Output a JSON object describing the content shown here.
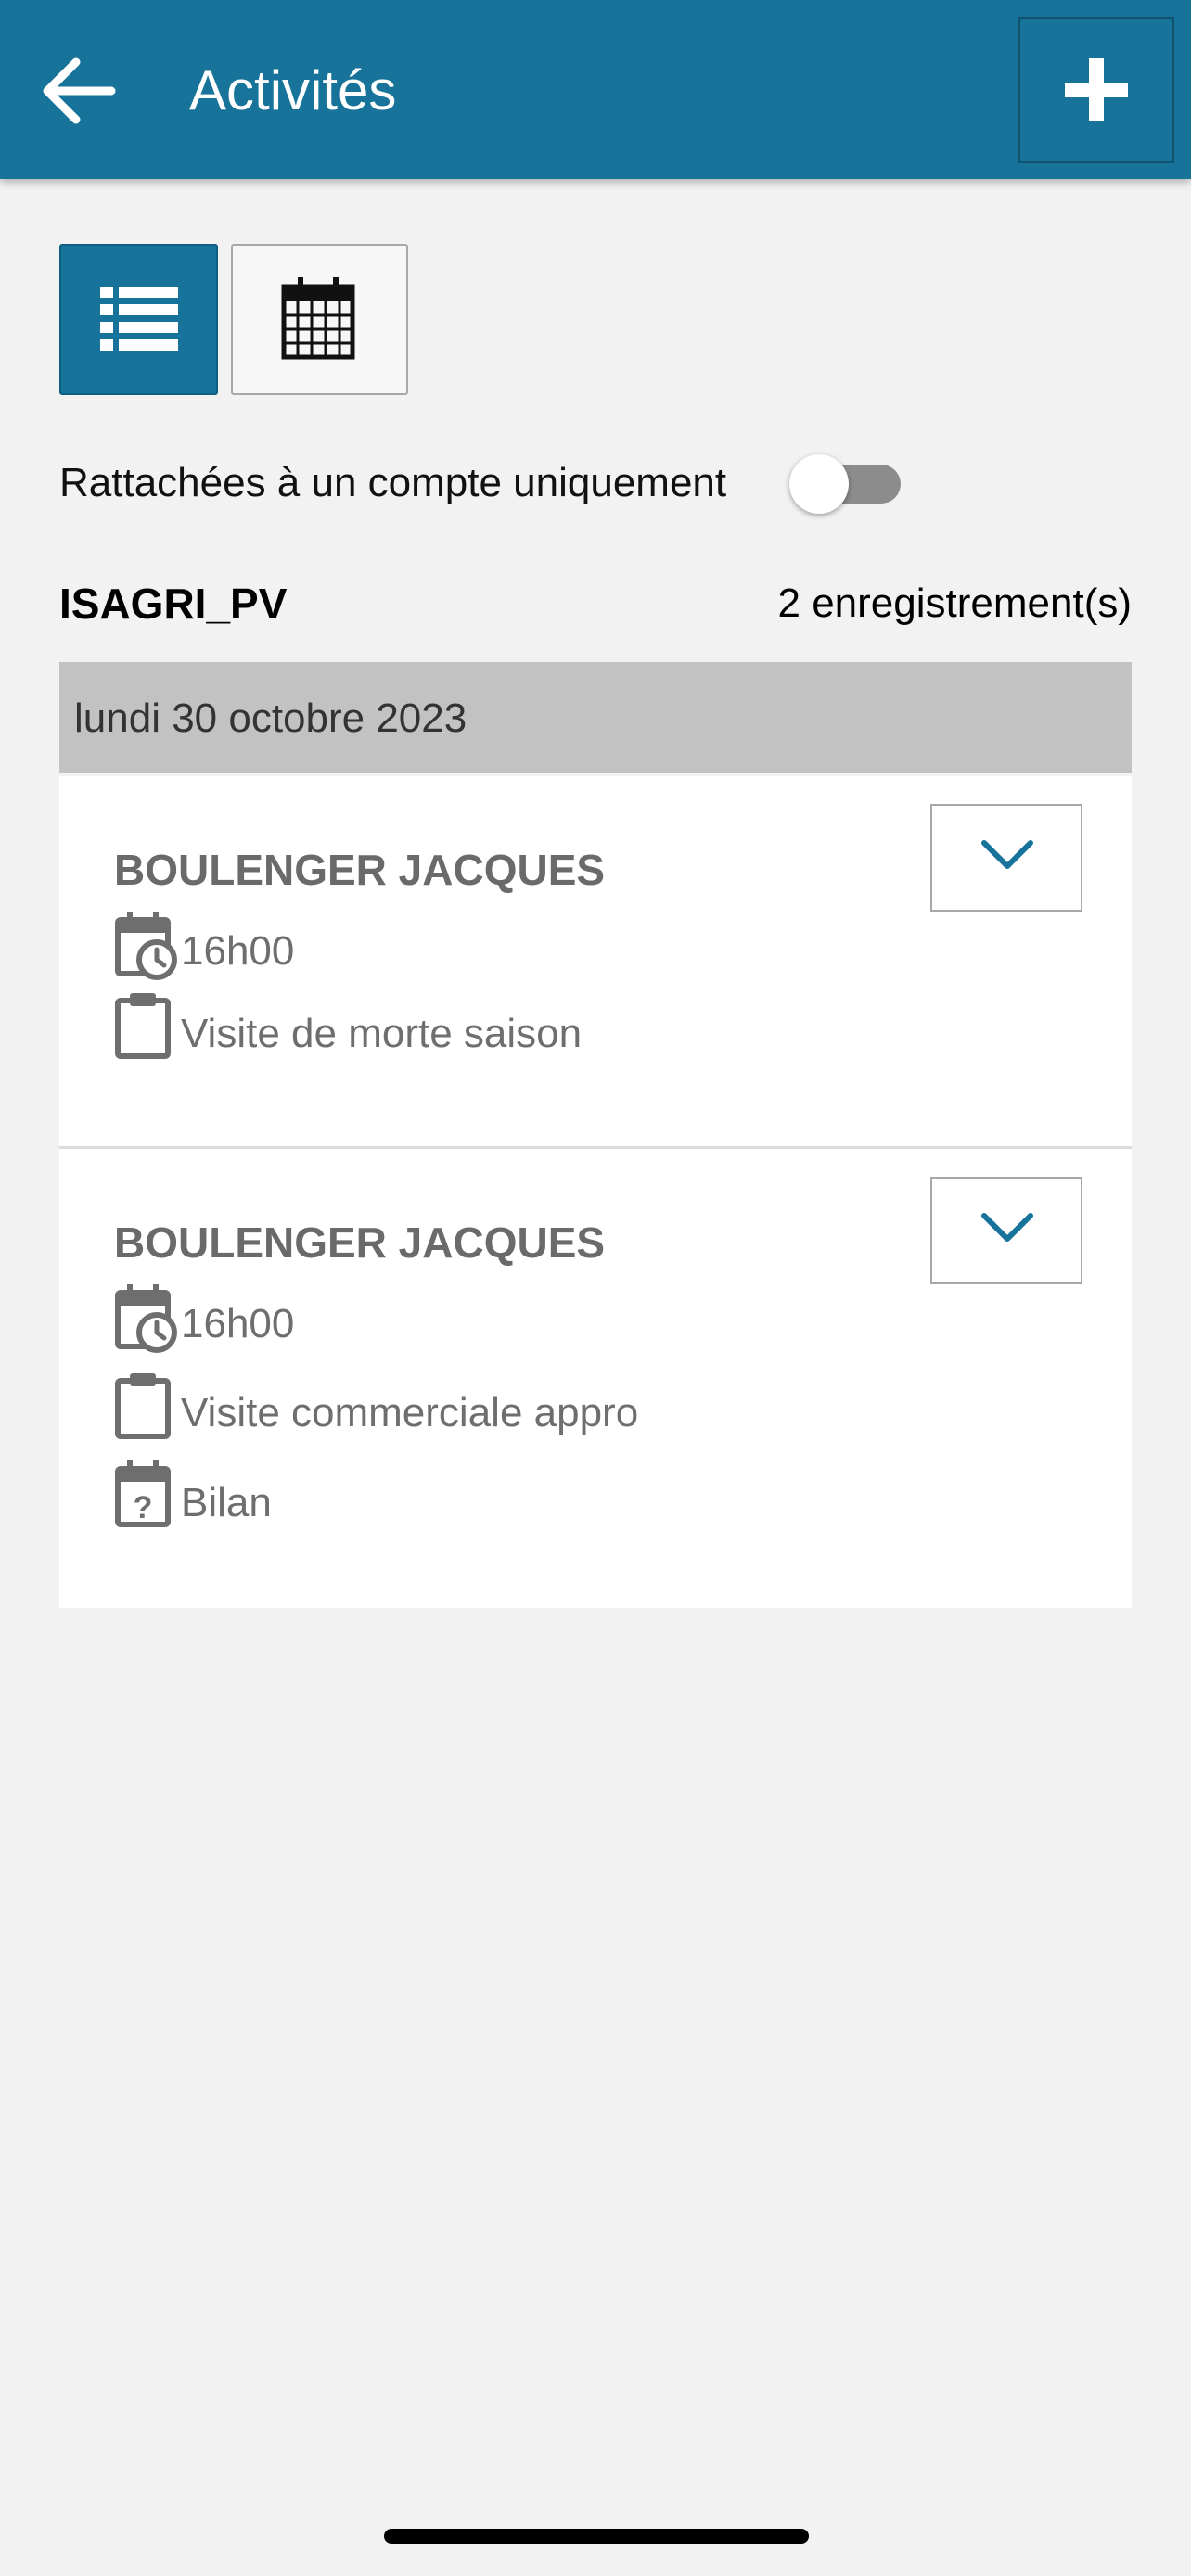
{
  "header": {
    "title": "Activités",
    "back_icon": "arrow-left-icon",
    "add_icon": "plus-icon",
    "background_color": "#17739a"
  },
  "view_toggle": {
    "list_icon": "list-icon",
    "calendar_icon": "calendar-icon",
    "selected": "list"
  },
  "filter": {
    "label": "Rattachées à un compte uniquement",
    "enabled": false
  },
  "summary": {
    "account": "ISAGRI_PV",
    "count_text": "2 enregistrement(s)"
  },
  "groups": [
    {
      "date": "lundi 30 octobre 2023",
      "items": [
        {
          "contact": "BOULENGER JACQUES",
          "time": "16h00",
          "type": "Visite de morte saison"
        },
        {
          "contact": "BOULENGER JACQUES",
          "time": "16h00",
          "type": "Visite commerciale appro",
          "subject": "Bilan"
        }
      ]
    }
  ]
}
